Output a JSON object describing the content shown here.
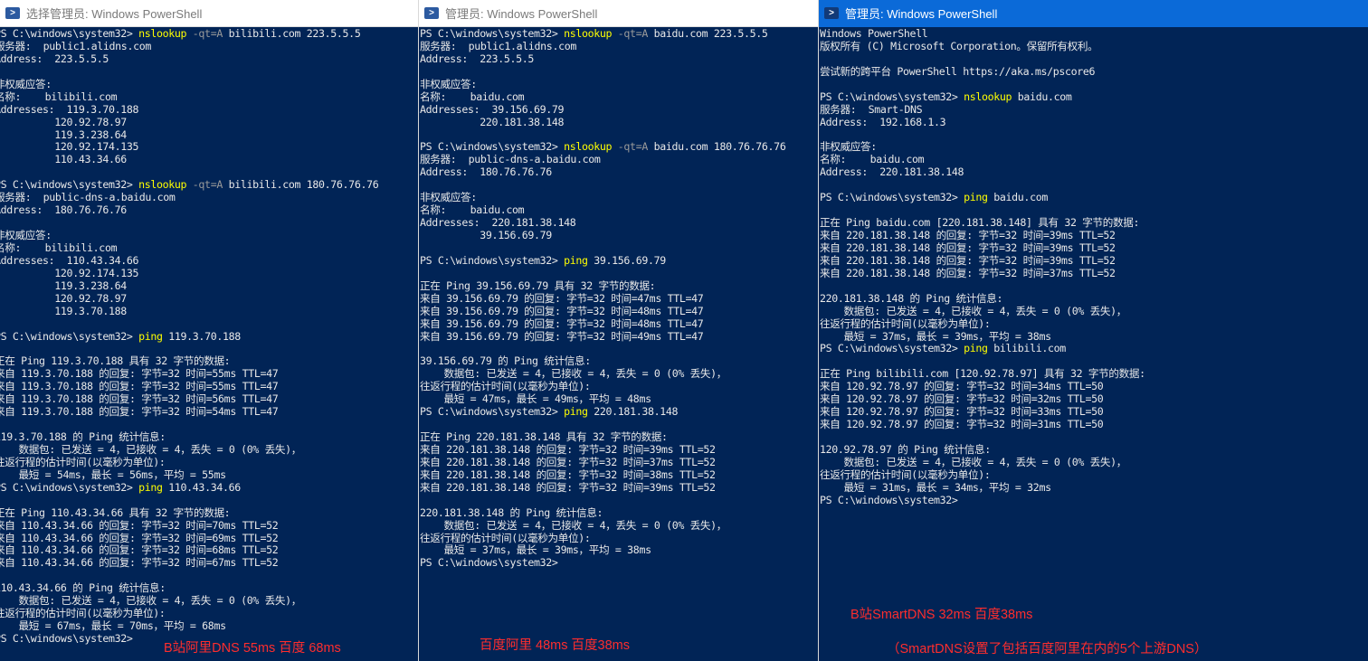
{
  "colors": {
    "console_bg": "#012456",
    "console_text": "#e8e8e8",
    "command": "#ffff00",
    "parameter": "#9a9a9a",
    "annotation": "#ff2d2d",
    "active_titlebar": "#0b6ad8"
  },
  "windows": [
    {
      "title": "选择管理员: Windows PowerShell",
      "active": false,
      "icon": "powershell-icon",
      "lines": [
        [
          {
            "t": "PS C:\\windows\\system32> "
          },
          {
            "t": "nslookup",
            "c": "cmd"
          },
          {
            "t": " -qt=A",
            "c": "param"
          },
          {
            "t": " bilibili.com 223.5.5.5"
          }
        ],
        [
          {
            "t": "服务器:  public1.alidns.com"
          }
        ],
        [
          {
            "t": "Address:  223.5.5.5"
          }
        ],
        [
          {
            "t": ""
          }
        ],
        [
          {
            "t": "非权威应答:"
          }
        ],
        [
          {
            "t": "名称:    bilibili.com"
          }
        ],
        [
          {
            "t": "Addresses:  119.3.70.188"
          }
        ],
        [
          {
            "t": "          120.92.78.97"
          }
        ],
        [
          {
            "t": "          119.3.238.64"
          }
        ],
        [
          {
            "t": "          120.92.174.135"
          }
        ],
        [
          {
            "t": "          110.43.34.66"
          }
        ],
        [
          {
            "t": ""
          }
        ],
        [
          {
            "t": "PS C:\\windows\\system32> "
          },
          {
            "t": "nslookup",
            "c": "cmd"
          },
          {
            "t": " -qt=A",
            "c": "param"
          },
          {
            "t": " bilibili.com 180.76.76.76"
          }
        ],
        [
          {
            "t": "服务器:  public-dns-a.baidu.com"
          }
        ],
        [
          {
            "t": "Address:  180.76.76.76"
          }
        ],
        [
          {
            "t": ""
          }
        ],
        [
          {
            "t": "非权威应答:"
          }
        ],
        [
          {
            "t": "名称:    bilibili.com"
          }
        ],
        [
          {
            "t": "Addresses:  110.43.34.66"
          }
        ],
        [
          {
            "t": "          120.92.174.135"
          }
        ],
        [
          {
            "t": "          119.3.238.64"
          }
        ],
        [
          {
            "t": "          120.92.78.97"
          }
        ],
        [
          {
            "t": "          119.3.70.188"
          }
        ],
        [
          {
            "t": ""
          }
        ],
        [
          {
            "t": "PS C:\\windows\\system32> "
          },
          {
            "t": "ping",
            "c": "cmd"
          },
          {
            "t": " 119.3.70.188"
          }
        ],
        [
          {
            "t": ""
          }
        ],
        [
          {
            "t": "正在 Ping 119.3.70.188 具有 32 字节的数据:"
          }
        ],
        [
          {
            "t": "来自 119.3.70.188 的回复: 字节=32 时间=55ms TTL=47"
          }
        ],
        [
          {
            "t": "来自 119.3.70.188 的回复: 字节=32 时间=55ms TTL=47"
          }
        ],
        [
          {
            "t": "来自 119.3.70.188 的回复: 字节=32 时间=56ms TTL=47"
          }
        ],
        [
          {
            "t": "来自 119.3.70.188 的回复: 字节=32 时间=54ms TTL=47"
          }
        ],
        [
          {
            "t": ""
          }
        ],
        [
          {
            "t": "119.3.70.188 的 Ping 统计信息:"
          }
        ],
        [
          {
            "t": "    数据包: 已发送 = 4，已接收 = 4，丢失 = 0 (0% 丢失)，"
          }
        ],
        [
          {
            "t": "往返行程的估计时间(以毫秒为单位):"
          }
        ],
        [
          {
            "t": "    最短 = 54ms，最长 = 56ms，平均 = 55ms"
          }
        ],
        [
          {
            "t": "PS C:\\windows\\system32> "
          },
          {
            "t": "ping",
            "c": "cmd"
          },
          {
            "t": " 110.43.34.66"
          }
        ],
        [
          {
            "t": ""
          }
        ],
        [
          {
            "t": "正在 Ping 110.43.34.66 具有 32 字节的数据:"
          }
        ],
        [
          {
            "t": "来自 110.43.34.66 的回复: 字节=32 时间=70ms TTL=52"
          }
        ],
        [
          {
            "t": "来自 110.43.34.66 的回复: 字节=32 时间=69ms TTL=52"
          }
        ],
        [
          {
            "t": "来自 110.43.34.66 的回复: 字节=32 时间=68ms TTL=52"
          }
        ],
        [
          {
            "t": "来自 110.43.34.66 的回复: 字节=32 时间=67ms TTL=52"
          }
        ],
        [
          {
            "t": ""
          }
        ],
        [
          {
            "t": "110.43.34.66 的 Ping 统计信息:"
          }
        ],
        [
          {
            "t": "    数据包: 已发送 = 4，已接收 = 4，丢失 = 0 (0% 丢失)，"
          }
        ],
        [
          {
            "t": "往返行程的估计时间(以毫秒为单位):"
          }
        ],
        [
          {
            "t": "    最短 = 67ms，最长 = 70ms，平均 = 68ms"
          }
        ],
        [
          {
            "t": "PS C:\\windows\\system32>"
          }
        ]
      ],
      "annotations": [
        "B站阿里DNS 55ms 百度 68ms"
      ]
    },
    {
      "title": "管理员: Windows PowerShell",
      "active": false,
      "icon": "powershell-icon",
      "lines": [
        [
          {
            "t": "PS C:\\windows\\system32> "
          },
          {
            "t": "nslookup",
            "c": "cmd"
          },
          {
            "t": " -qt=A",
            "c": "param"
          },
          {
            "t": " baidu.com 223.5.5.5"
          }
        ],
        [
          {
            "t": "服务器:  public1.alidns.com"
          }
        ],
        [
          {
            "t": "Address:  223.5.5.5"
          }
        ],
        [
          {
            "t": ""
          }
        ],
        [
          {
            "t": "非权威应答:"
          }
        ],
        [
          {
            "t": "名称:    baidu.com"
          }
        ],
        [
          {
            "t": "Addresses:  39.156.69.79"
          }
        ],
        [
          {
            "t": "          220.181.38.148"
          }
        ],
        [
          {
            "t": ""
          }
        ],
        [
          {
            "t": "PS C:\\windows\\system32> "
          },
          {
            "t": "nslookup",
            "c": "cmd"
          },
          {
            "t": " -qt=A",
            "c": "param"
          },
          {
            "t": " baidu.com 180.76.76.76"
          }
        ],
        [
          {
            "t": "服务器:  public-dns-a.baidu.com"
          }
        ],
        [
          {
            "t": "Address:  180.76.76.76"
          }
        ],
        [
          {
            "t": ""
          }
        ],
        [
          {
            "t": "非权威应答:"
          }
        ],
        [
          {
            "t": "名称:    baidu.com"
          }
        ],
        [
          {
            "t": "Addresses:  220.181.38.148"
          }
        ],
        [
          {
            "t": "          39.156.69.79"
          }
        ],
        [
          {
            "t": ""
          }
        ],
        [
          {
            "t": "PS C:\\windows\\system32> "
          },
          {
            "t": "ping",
            "c": "cmd"
          },
          {
            "t": " 39.156.69.79"
          }
        ],
        [
          {
            "t": ""
          }
        ],
        [
          {
            "t": "正在 Ping 39.156.69.79 具有 32 字节的数据:"
          }
        ],
        [
          {
            "t": "来自 39.156.69.79 的回复: 字节=32 时间=47ms TTL=47"
          }
        ],
        [
          {
            "t": "来自 39.156.69.79 的回复: 字节=32 时间=48ms TTL=47"
          }
        ],
        [
          {
            "t": "来自 39.156.69.79 的回复: 字节=32 时间=48ms TTL=47"
          }
        ],
        [
          {
            "t": "来自 39.156.69.79 的回复: 字节=32 时间=49ms TTL=47"
          }
        ],
        [
          {
            "t": ""
          }
        ],
        [
          {
            "t": "39.156.69.79 的 Ping 统计信息:"
          }
        ],
        [
          {
            "t": "    数据包: 已发送 = 4，已接收 = 4，丢失 = 0 (0% 丢失)，"
          }
        ],
        [
          {
            "t": "往返行程的估计时间(以毫秒为单位):"
          }
        ],
        [
          {
            "t": "    最短 = 47ms，最长 = 49ms，平均 = 48ms"
          }
        ],
        [
          {
            "t": "PS C:\\windows\\system32> "
          },
          {
            "t": "ping",
            "c": "cmd"
          },
          {
            "t": " 220.181.38.148"
          }
        ],
        [
          {
            "t": ""
          }
        ],
        [
          {
            "t": "正在 Ping 220.181.38.148 具有 32 字节的数据:"
          }
        ],
        [
          {
            "t": "来自 220.181.38.148 的回复: 字节=32 时间=39ms TTL=52"
          }
        ],
        [
          {
            "t": "来自 220.181.38.148 的回复: 字节=32 时间=37ms TTL=52"
          }
        ],
        [
          {
            "t": "来自 220.181.38.148 的回复: 字节=32 时间=38ms TTL=52"
          }
        ],
        [
          {
            "t": "来自 220.181.38.148 的回复: 字节=32 时间=39ms TTL=52"
          }
        ],
        [
          {
            "t": ""
          }
        ],
        [
          {
            "t": "220.181.38.148 的 Ping 统计信息:"
          }
        ],
        [
          {
            "t": "    数据包: 已发送 = 4，已接收 = 4，丢失 = 0 (0% 丢失)，"
          }
        ],
        [
          {
            "t": "往返行程的估计时间(以毫秒为单位):"
          }
        ],
        [
          {
            "t": "    最短 = 37ms，最长 = 39ms，平均 = 38ms"
          }
        ],
        [
          {
            "t": "PS C:\\windows\\system32>"
          }
        ]
      ],
      "annotations": [
        "百度阿里 48ms 百度38ms"
      ]
    },
    {
      "title": "管理员: Windows PowerShell",
      "active": true,
      "icon": "powershell-icon",
      "lines": [
        [
          {
            "t": "Windows PowerShell"
          }
        ],
        [
          {
            "t": "版权所有 (C) Microsoft Corporation。保留所有权利。"
          }
        ],
        [
          {
            "t": ""
          }
        ],
        [
          {
            "t": "尝试新的跨平台 PowerShell https://aka.ms/pscore6"
          }
        ],
        [
          {
            "t": ""
          }
        ],
        [
          {
            "t": "PS C:\\windows\\system32> "
          },
          {
            "t": "nslookup",
            "c": "cmd"
          },
          {
            "t": " baidu.com"
          }
        ],
        [
          {
            "t": "服务器:  Smart-DNS"
          }
        ],
        [
          {
            "t": "Address:  192.168.1.3"
          }
        ],
        [
          {
            "t": ""
          }
        ],
        [
          {
            "t": "非权威应答:"
          }
        ],
        [
          {
            "t": "名称:    baidu.com"
          }
        ],
        [
          {
            "t": "Address:  220.181.38.148"
          }
        ],
        [
          {
            "t": ""
          }
        ],
        [
          {
            "t": "PS C:\\windows\\system32> "
          },
          {
            "t": "ping",
            "c": "cmd"
          },
          {
            "t": " baidu.com"
          }
        ],
        [
          {
            "t": ""
          }
        ],
        [
          {
            "t": "正在 Ping baidu.com [220.181.38.148] 具有 32 字节的数据:"
          }
        ],
        [
          {
            "t": "来自 220.181.38.148 的回复: 字节=32 时间=39ms TTL=52"
          }
        ],
        [
          {
            "t": "来自 220.181.38.148 的回复: 字节=32 时间=39ms TTL=52"
          }
        ],
        [
          {
            "t": "来自 220.181.38.148 的回复: 字节=32 时间=39ms TTL=52"
          }
        ],
        [
          {
            "t": "来自 220.181.38.148 的回复: 字节=32 时间=37ms TTL=52"
          }
        ],
        [
          {
            "t": ""
          }
        ],
        [
          {
            "t": "220.181.38.148 的 Ping 统计信息:"
          }
        ],
        [
          {
            "t": "    数据包: 已发送 = 4，已接收 = 4，丢失 = 0 (0% 丢失)，"
          }
        ],
        [
          {
            "t": "往返行程的估计时间(以毫秒为单位):"
          }
        ],
        [
          {
            "t": "    最短 = 37ms，最长 = 39ms，平均 = 38ms"
          }
        ],
        [
          {
            "t": "PS C:\\windows\\system32> "
          },
          {
            "t": "ping",
            "c": "cmd"
          },
          {
            "t": " bilibili.com"
          }
        ],
        [
          {
            "t": ""
          }
        ],
        [
          {
            "t": "正在 Ping bilibili.com [120.92.78.97] 具有 32 字节的数据:"
          }
        ],
        [
          {
            "t": "来自 120.92.78.97 的回复: 字节=32 时间=34ms TTL=50"
          }
        ],
        [
          {
            "t": "来自 120.92.78.97 的回复: 字节=32 时间=32ms TTL=50"
          }
        ],
        [
          {
            "t": "来自 120.92.78.97 的回复: 字节=32 时间=33ms TTL=50"
          }
        ],
        [
          {
            "t": "来自 120.92.78.97 的回复: 字节=32 时间=31ms TTL=50"
          }
        ],
        [
          {
            "t": ""
          }
        ],
        [
          {
            "t": "120.92.78.97 的 Ping 统计信息:"
          }
        ],
        [
          {
            "t": "    数据包: 已发送 = 4，已接收 = 4，丢失 = 0 (0% 丢失)，"
          }
        ],
        [
          {
            "t": "往返行程的估计时间(以毫秒为单位):"
          }
        ],
        [
          {
            "t": "    最短 = 31ms，最长 = 34ms，平均 = 32ms"
          }
        ],
        [
          {
            "t": "PS C:\\windows\\system32>"
          }
        ]
      ],
      "annotations": [
        "B站SmartDNS 32ms 百度38ms",
        "（SmartDNS设置了包括百度阿里在内的5个上游DNS）"
      ]
    }
  ]
}
